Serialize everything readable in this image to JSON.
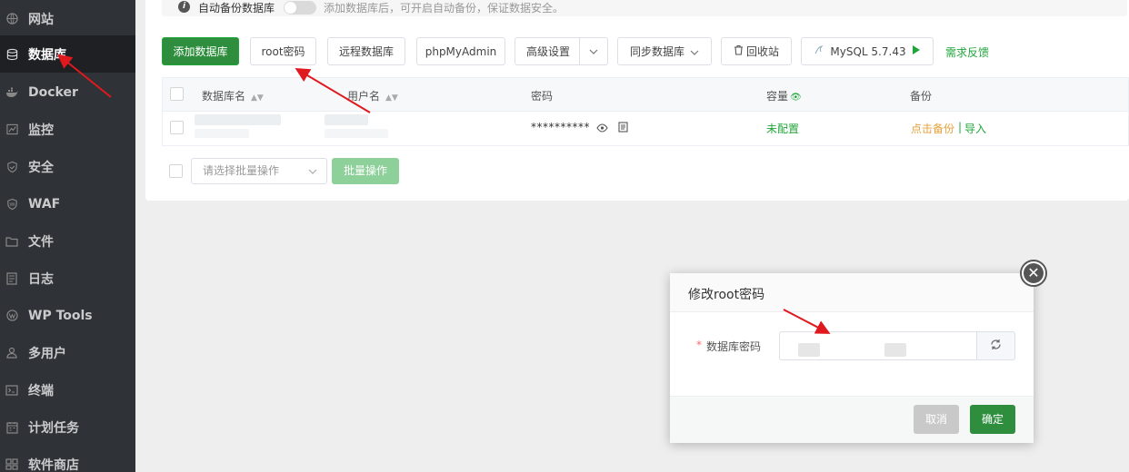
{
  "sidebar": {
    "items": [
      {
        "label": "网站",
        "icon": "globe-icon"
      },
      {
        "label": "数据库",
        "icon": "database-icon",
        "active": true
      },
      {
        "label": "Docker",
        "icon": "docker-icon"
      },
      {
        "label": "监控",
        "icon": "monitor-icon"
      },
      {
        "label": "安全",
        "icon": "shield-icon"
      },
      {
        "label": "WAF",
        "icon": "waf-shield-icon"
      },
      {
        "label": "文件",
        "icon": "folder-icon"
      },
      {
        "label": "日志",
        "icon": "log-icon"
      },
      {
        "label": "WP Tools",
        "icon": "wordpress-icon"
      },
      {
        "label": "多用户",
        "icon": "users-icon"
      },
      {
        "label": "终端",
        "icon": "terminal-icon"
      },
      {
        "label": "计划任务",
        "icon": "calendar-icon"
      },
      {
        "label": "软件商店",
        "icon": "store-icon"
      }
    ]
  },
  "notice": {
    "label": "自动备份数据库",
    "description": "添加数据库后，可开启自动备份，保证数据安全。"
  },
  "toolbar": {
    "add_db": "添加数据库",
    "root_password": "root密码",
    "remote_db": "远程数据库",
    "phpmyadmin": "phpMyAdmin",
    "advanced": "高级设置",
    "sync_db": "同步数据库",
    "recycle": "回收站",
    "mysql_version": "MySQL 5.7.43",
    "feedback": "需求反馈"
  },
  "table": {
    "columns": [
      "数据库名",
      "用户名",
      "密码",
      "容量",
      "备份"
    ],
    "rows": [
      {
        "password": "**********",
        "capacity": "未配置",
        "backup": "点击备份",
        "separator": "|",
        "import": "导入"
      }
    ]
  },
  "batch": {
    "placeholder": "请选择批量操作",
    "button": "批量操作"
  },
  "dialog": {
    "title": "修改root密码",
    "required_mark": "*",
    "field_label": "数据库密码",
    "cancel": "取消",
    "confirm": "确定"
  },
  "colors": {
    "accent": "#20a53a",
    "arrow": "#e0191e",
    "backup_link": "#e6a23c"
  }
}
